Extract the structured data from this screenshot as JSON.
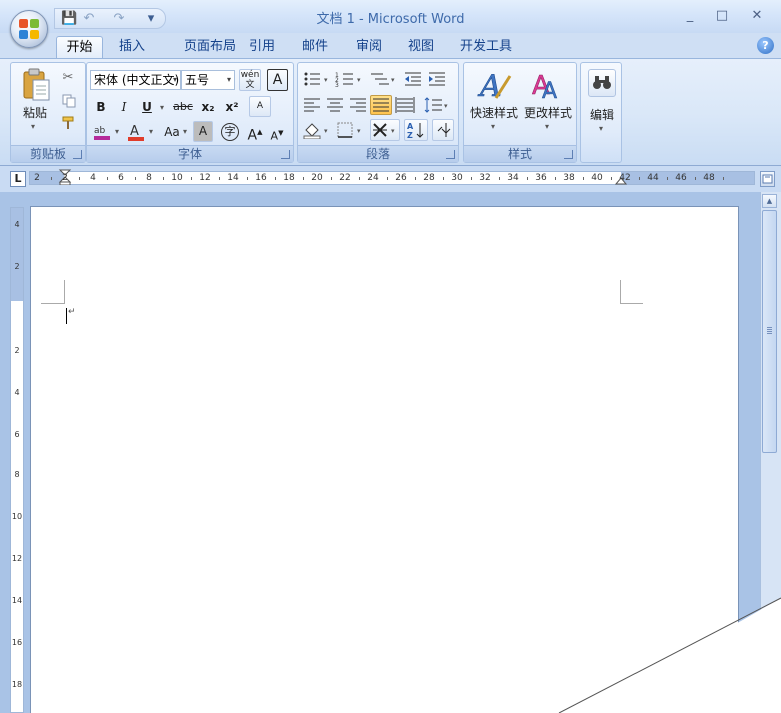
{
  "window": {
    "title": "文档 1 - Microsoft Word",
    "controls": [
      "_",
      "□",
      "✕"
    ]
  },
  "qat": {
    "save": "💾",
    "undo": "↶",
    "redo": "↷",
    "customize": "▾"
  },
  "tabs": [
    "开始",
    "插入",
    "页面布局",
    "引用",
    "邮件",
    "审阅",
    "视图",
    "开发工具"
  ],
  "help": "?",
  "clipboard": {
    "paste_label": "粘贴",
    "group_label": "剪贴板"
  },
  "font": {
    "face": "宋体 (中文正文)",
    "size": "五号",
    "group_label": "字体",
    "buttons": {
      "bold": "B",
      "italic": "I",
      "underline": "U",
      "strike": "abc",
      "sub": "x₂",
      "sup": "x²",
      "grow": "A",
      "shrink": "A",
      "case": "Aa",
      "shade": "A",
      "enclose": "字",
      "clear": "A",
      "phonetic": "wén"
    }
  },
  "paragraph": {
    "group_label": "段落"
  },
  "styles": {
    "quick_label": "快速样式",
    "change_label": "更改样式",
    "group_label": "样式"
  },
  "editing": {
    "label": "编辑"
  },
  "ruler": {
    "tab_selector": "L",
    "labels": [
      "2",
      "2",
      "4",
      "6",
      "8",
      "10",
      "12",
      "14",
      "16",
      "18",
      "20",
      "22",
      "24",
      "26",
      "28",
      "30",
      "32",
      "34",
      "36",
      "38",
      "40",
      "42",
      "44",
      "46",
      "48"
    ]
  },
  "vruler": {
    "labels": [
      "4",
      "2",
      "2",
      "4",
      "6",
      "8",
      "10",
      "12",
      "14",
      "16",
      "18"
    ]
  }
}
